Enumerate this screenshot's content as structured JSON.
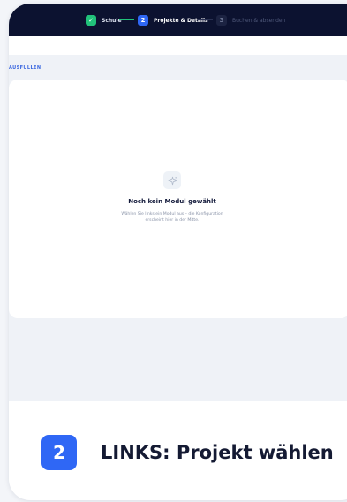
{
  "progress": {
    "steps": [
      {
        "number": "✓",
        "label": "Schule",
        "state": "done"
      },
      {
        "number": "2",
        "label": "Projekte & Details",
        "state": "active"
      },
      {
        "number": "3",
        "label": "Buchen & absenden",
        "state": "pending"
      }
    ]
  },
  "section": {
    "label": "AUSFÜLLEN"
  },
  "empty_state": {
    "icon": "sparkle-icon",
    "title": "Noch kein Modul gewählt",
    "description": "Wählen Sie links ein Modul aus – die Konfiguration erscheint hier in der Mitte."
  },
  "caption": {
    "number": "2",
    "text": "LINKS: Projekt wählen"
  },
  "colors": {
    "topbar": "#0c1230",
    "done": "#21c17a",
    "active": "#2f67f5",
    "pending": "#1c2342",
    "accent_text": "#3a67e0"
  }
}
